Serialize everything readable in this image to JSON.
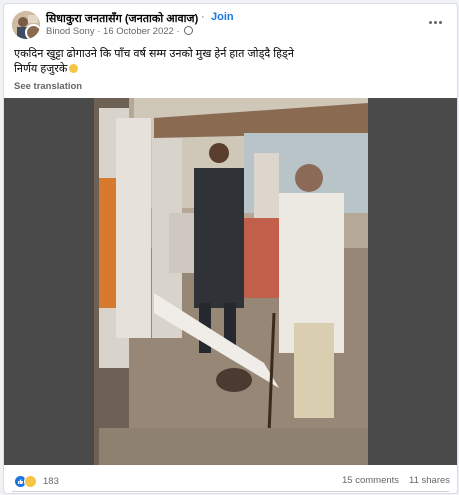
{
  "post": {
    "page_name": "सिधाकुरा जनतासँग (जनताको आवाज)",
    "separator": "·",
    "join_label": "Join",
    "author": "Binod Sony",
    "date": "16 October 2022",
    "meta_separator": "·",
    "caption_line1": "एकदिन खुट्टा ढोगाउने कि पाँच वर्ष सम्म उनको मुख हेर्न हात जोड्दै हिड्ने",
    "caption_line2": "निर्णय हजुरके",
    "see_translation": "See translation"
  },
  "footer": {
    "reaction_count": "183",
    "comments": "15 comments",
    "shares": "11 shares"
  },
  "colors": {
    "accent": "#1b74e4",
    "secondary_text": "#65676b",
    "background": "#f0f2f5"
  },
  "icons": [
    "globe-icon",
    "more-options-icon",
    "like-reaction-icon",
    "haha-reaction-icon"
  ]
}
